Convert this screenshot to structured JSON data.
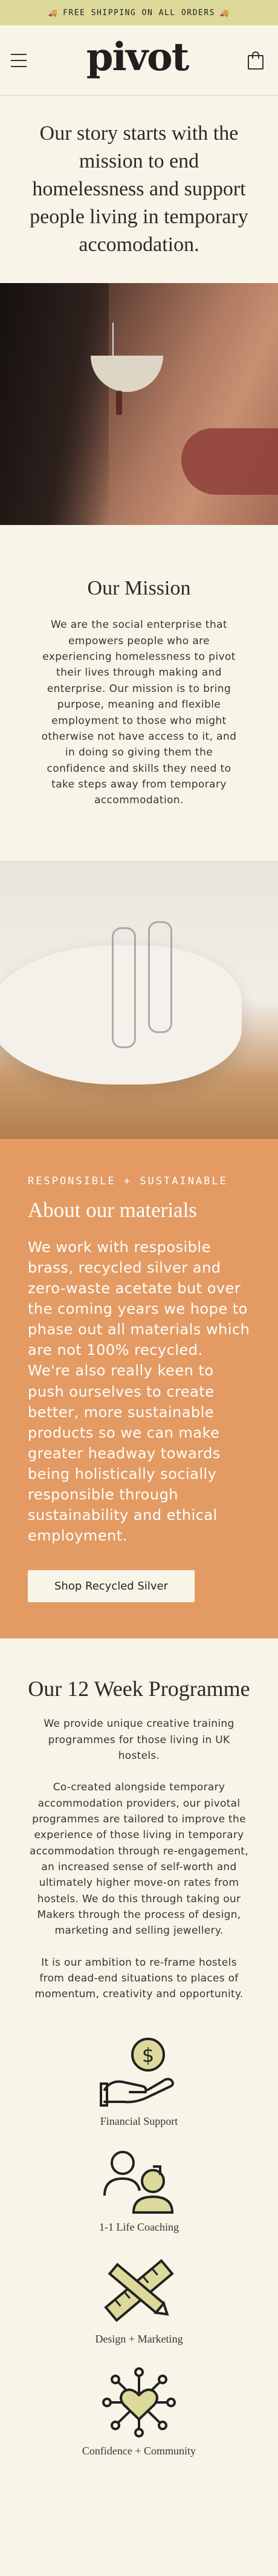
{
  "announcement": {
    "text": "FREE SHIPPING ON ALL ORDERS"
  },
  "header": {
    "logo": "pivot"
  },
  "intro": {
    "headline": "Our story starts with the mission to end homelessness and support people living in temporary accomodation."
  },
  "mission": {
    "title": "Our Mission",
    "body": "We are the social enterprise that empowers people who are experiencing homelessness to pivot their lives through making and enterprise. Our mission is to bring purpose, meaning and flexible employment to those who might otherwise not have access to it, and in doing so giving them the confidence and skills they need to take steps away from temporary accommodation."
  },
  "materials": {
    "eyebrow": "RESPONSIBLE + SUSTAINABLE",
    "title": "About our materials",
    "body": "We work with resposible brass, recycled silver and zero-waste acetate but over the coming years we hope to phase out all materials which are not 100% recycled. We're also really keen to push ourselves to create better, more sustainable products so we can make greater headway towards being holistically socially responsible through sustainability and ethical employment.",
    "button": "Shop Recycled Silver"
  },
  "programme": {
    "title": "Our 12 Week Programme",
    "p1": "We provide unique creative training programmes for those living in UK hostels.",
    "p2": "Co-created alongside temporary accommodation providers, our pivotal programmes are tailored to improve the experience of those living in temporary accommodation through re-engagement, an increased sense of self-worth and ultimately higher move-on rates from hostels. We do this through taking our Makers through the process of design, marketing and selling jewellery.",
    "p3": "It is our ambition to re-frame hostels from dead-end situations to places of momentum, creativity and opportunity."
  },
  "features": [
    {
      "label": "Financial Support",
      "icon": "hand-coin-icon"
    },
    {
      "label": "1-1 Life Coaching",
      "icon": "people-icon"
    },
    {
      "label": "Design + Marketing",
      "icon": "ruler-pencil-icon"
    },
    {
      "label": "Confidence + Community",
      "icon": "heart-network-icon"
    }
  ],
  "colors": {
    "announce_bg": "#dcd99b",
    "materials_bg": "#e39b63",
    "page_bg": "#f8f5e8",
    "icon_fill": "#dcd99b"
  }
}
